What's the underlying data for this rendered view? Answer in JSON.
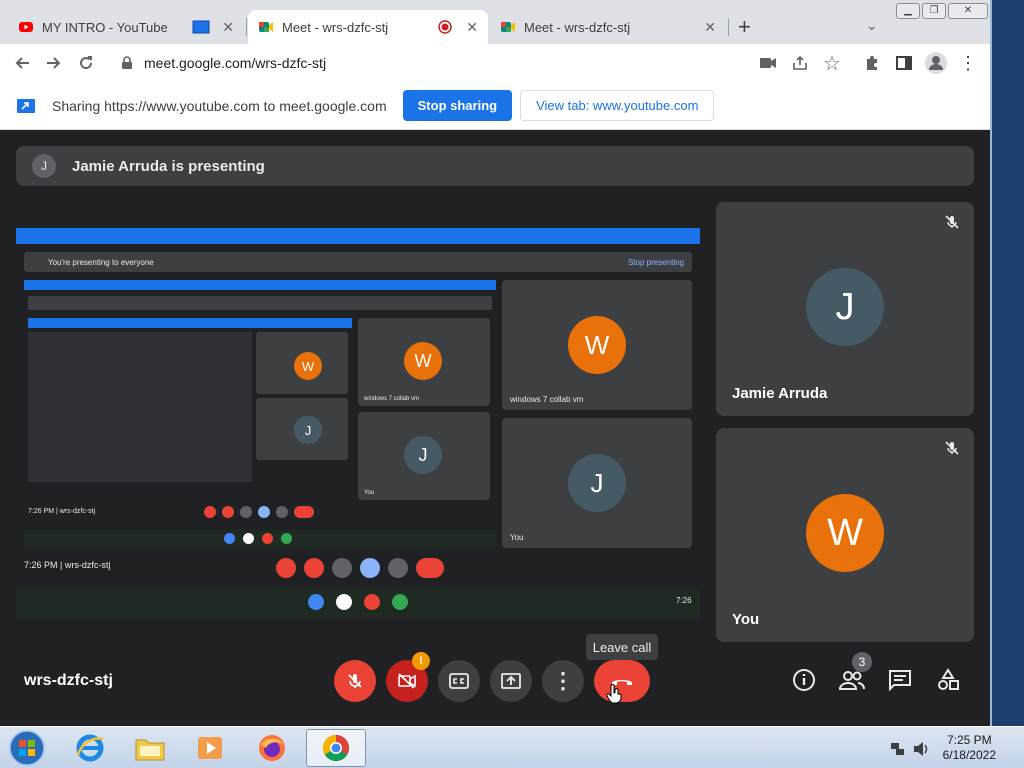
{
  "browser": {
    "tabs": [
      {
        "title": "MY INTRO - YouTube",
        "active": false
      },
      {
        "title": "Meet - wrs-dzfc-stj",
        "active": true
      },
      {
        "title": "Meet - wrs-dzfc-stj",
        "active": false
      }
    ],
    "new_tab_label": "+",
    "url": "meet.google.com/wrs-dzfc-stj"
  },
  "infobar": {
    "message": "Sharing https://www.youtube.com to meet.google.com",
    "stop_sharing_label": "Stop sharing",
    "view_tab_label": "View tab: www.youtube.com"
  },
  "meet": {
    "presenting_banner": {
      "initial": "J",
      "text": "Jamie Arruda is presenting"
    },
    "shared_screen": {
      "presenting_text": "You're presenting to everyone",
      "stop_presenting": "Stop presenting",
      "time_code": "7:26 PM  |  wrs-dzfc-stj",
      "tile_names": [
        "windows 7 collab vm",
        "You"
      ],
      "tile_initials": [
        "W",
        "J"
      ],
      "clock": "7:26"
    },
    "participants": [
      {
        "name": "Jamie Arruda",
        "initial": "J",
        "avatar_color": "#455a64",
        "muted": true
      },
      {
        "name": "You",
        "initial": "W",
        "avatar_color": "#e8710a",
        "muted": true
      }
    ],
    "meeting_code": "wrs-dzfc-stj",
    "tooltip": "Leave call",
    "camera_alert": "!",
    "participant_count": "3"
  },
  "taskbar": {
    "time": "7:25 PM",
    "date": "6/18/2022"
  },
  "colors": {
    "accent": "#1a73e8",
    "danger": "#ea4335",
    "tile": "#3c4043",
    "orange": "#e8710a"
  }
}
